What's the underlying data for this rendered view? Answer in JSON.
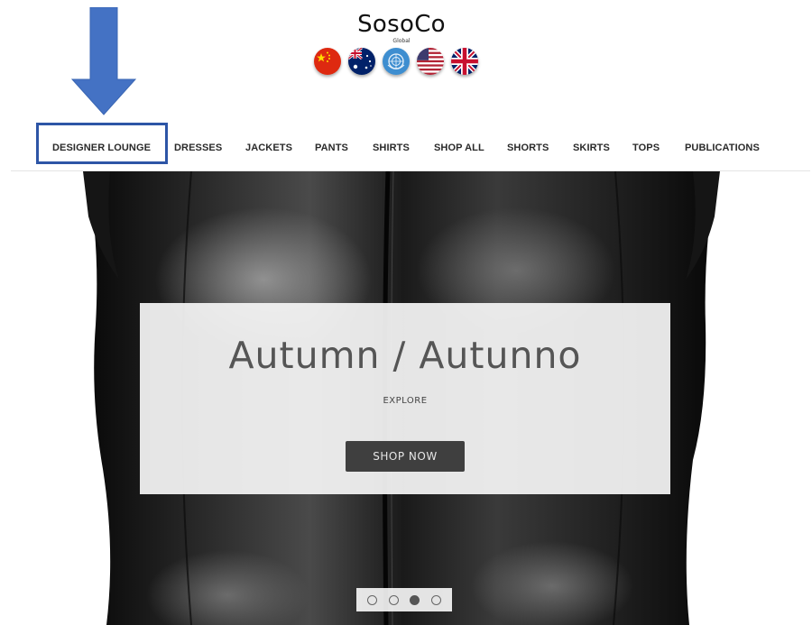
{
  "brand": {
    "name": "SosoCo",
    "subtitle": "Global"
  },
  "flags": [
    {
      "icon": "china-flag-icon"
    },
    {
      "icon": "australia-flag-icon"
    },
    {
      "icon": "un-flag-icon"
    },
    {
      "icon": "usa-flag-icon"
    },
    {
      "icon": "uk-flag-icon"
    }
  ],
  "annotation": {
    "color": "#4472c4",
    "highlight_color": "#2d55a6"
  },
  "nav": {
    "items": [
      {
        "label": "DESIGNER LOUNGE"
      },
      {
        "label": "DRESSES"
      },
      {
        "label": "JACKETS"
      },
      {
        "label": "PANTS"
      },
      {
        "label": "SHIRTS"
      },
      {
        "label": "SHOP ALL"
      },
      {
        "label": "SHORTS"
      },
      {
        "label": "SKIRTS"
      },
      {
        "label": "TOPS"
      },
      {
        "label": "PUBLICATIONS"
      }
    ]
  },
  "hero": {
    "title": "Autumn / Autunno",
    "subtitle": "EXPLORE",
    "button_label": "SHOP NOW",
    "slides_total": 4,
    "active_slide": 3
  }
}
